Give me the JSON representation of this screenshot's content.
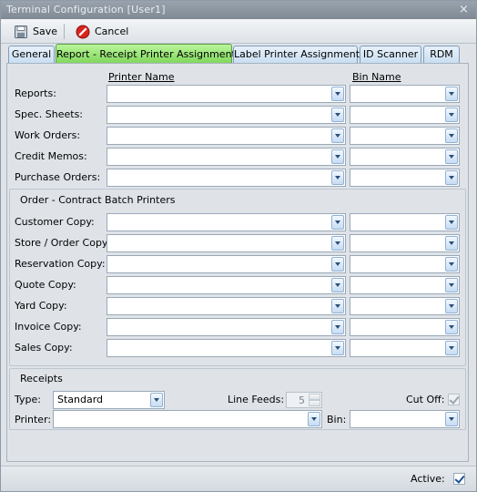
{
  "window": {
    "title": "Terminal Configuration [User1]",
    "close_glyph": "×"
  },
  "toolbar": {
    "save_label": "Save",
    "cancel_label": "Cancel"
  },
  "tabs": [
    {
      "label": "General"
    },
    {
      "label": "Report - Receipt Printer Assignments"
    },
    {
      "label": "Label Printer Assignments"
    },
    {
      "label": "ID Scanner"
    },
    {
      "label": "RDM"
    }
  ],
  "report_section": {
    "printer_header": "Printer Name",
    "bin_header": "Bin Name",
    "rows": [
      {
        "label": "Reports:",
        "printer": "",
        "bin": ""
      },
      {
        "label": "Spec. Sheets:",
        "printer": "",
        "bin": ""
      },
      {
        "label": "Work Orders:",
        "printer": "",
        "bin": ""
      },
      {
        "label": "Credit Memos:",
        "printer": "",
        "bin": ""
      },
      {
        "label": "Purchase Orders:",
        "printer": "",
        "bin": ""
      }
    ]
  },
  "batch_section": {
    "title": "Order - Contract Batch Printers",
    "rows": [
      {
        "label": "Customer Copy:",
        "printer": "",
        "bin": ""
      },
      {
        "label": "Store / Order Copy:",
        "printer": "",
        "bin": ""
      },
      {
        "label": "Reservation Copy:",
        "printer": "",
        "bin": ""
      },
      {
        "label": "Quote Copy:",
        "printer": "",
        "bin": ""
      },
      {
        "label": "Yard Copy:",
        "printer": "",
        "bin": ""
      },
      {
        "label": "Invoice Copy:",
        "printer": "",
        "bin": ""
      },
      {
        "label": "Sales Copy:",
        "printer": "",
        "bin": ""
      }
    ]
  },
  "receipts": {
    "title": "Receipts",
    "type_label": "Type:",
    "type_value": "Standard",
    "line_feeds_label": "Line Feeds:",
    "line_feeds_value": "5",
    "cut_off_label": "Cut Off:",
    "cut_off_checked": true,
    "printer_label": "Printer:",
    "printer_value": "",
    "bin_label": "Bin:",
    "bin_value": ""
  },
  "footer": {
    "active_label": "Active:",
    "active_checked": true
  },
  "colors": {
    "active_tab": "#7fd65a",
    "tab": "#c8ddf1",
    "accent": "#1a4f9c"
  }
}
